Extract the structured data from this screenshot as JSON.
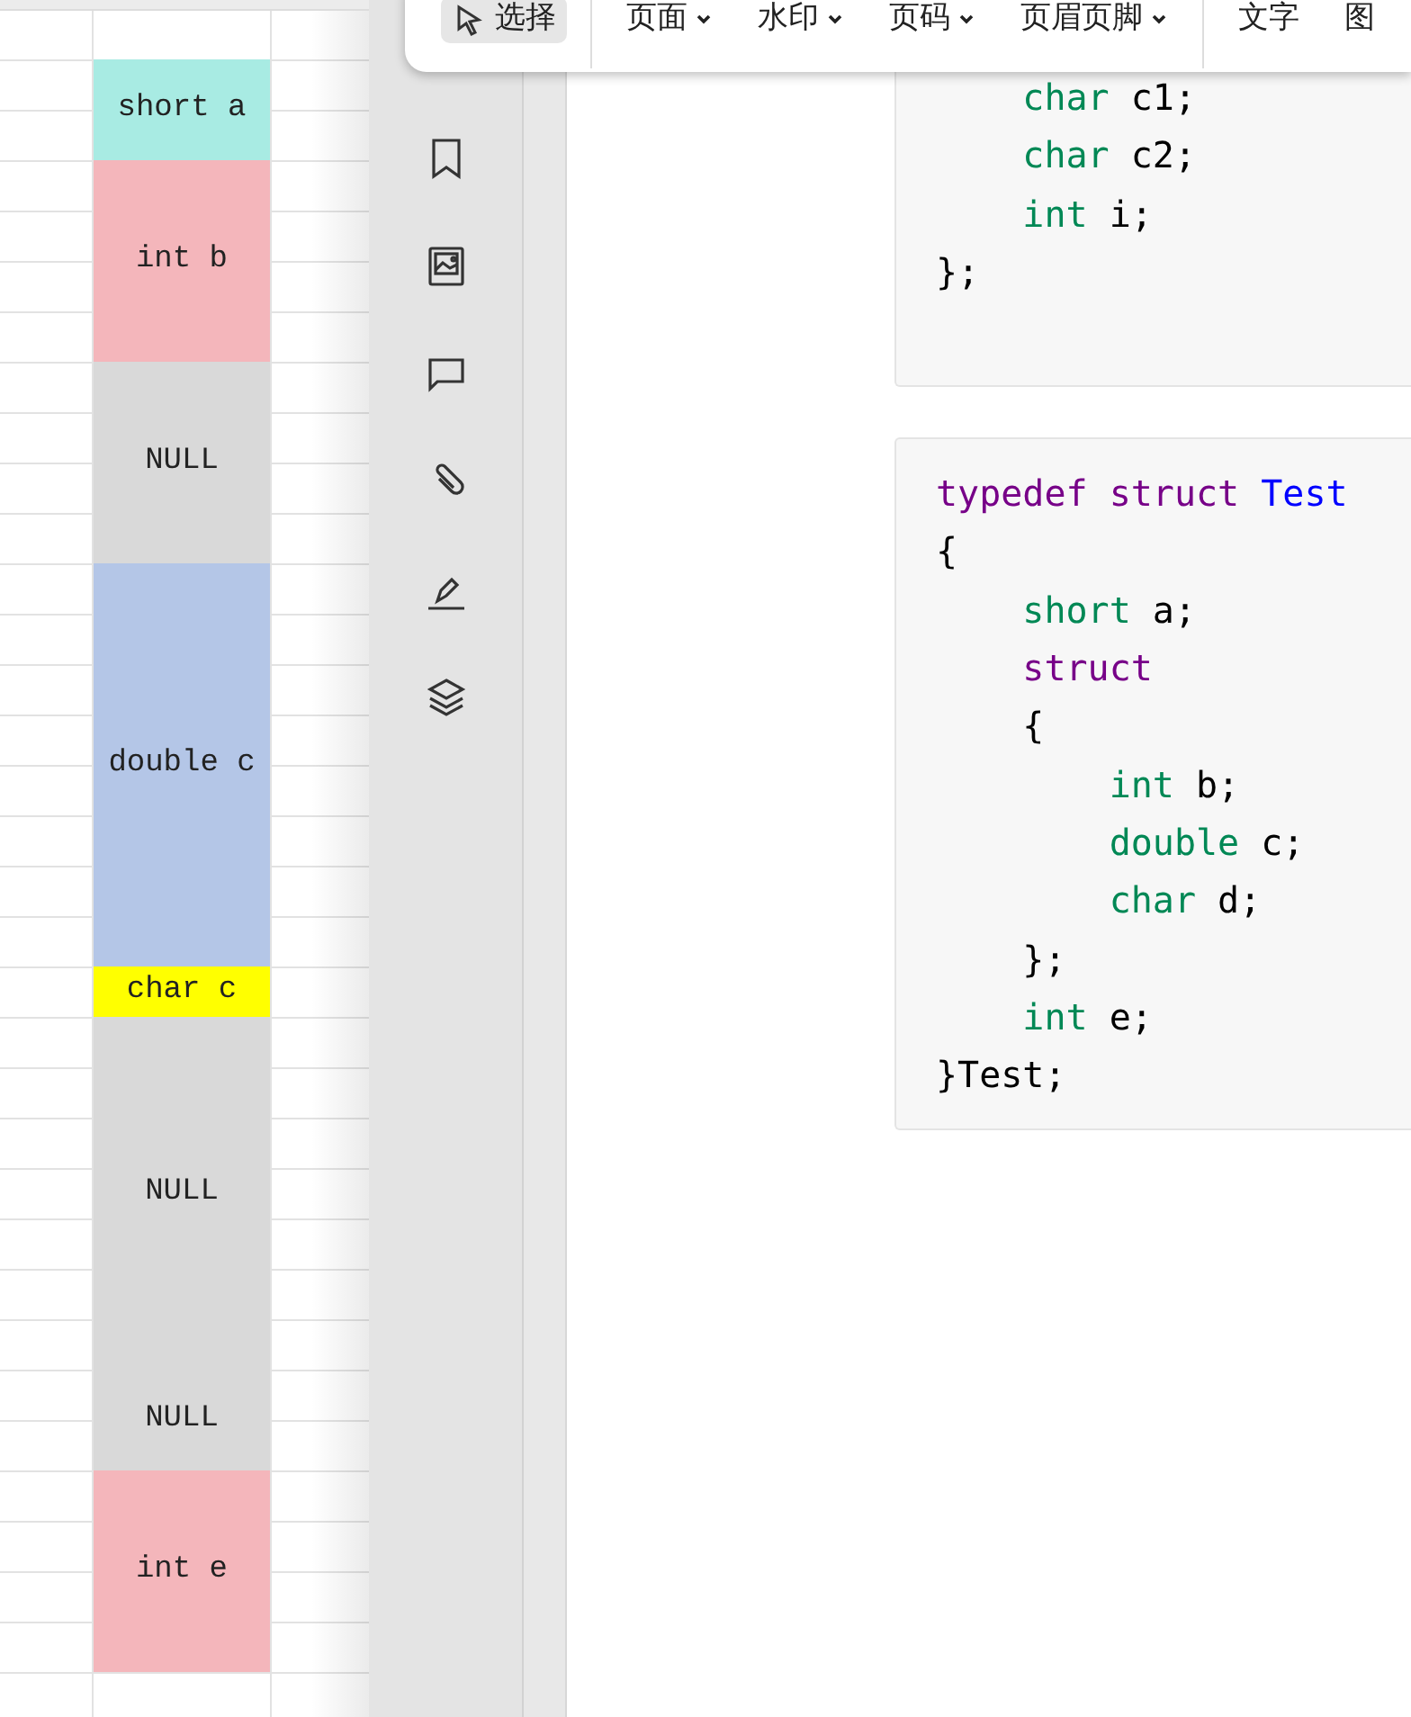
{
  "sheet": {
    "cells": [
      {
        "text": "short a",
        "color": "#a8ebe3"
      },
      {
        "text": "int b",
        "color": "#f4b6bb"
      },
      {
        "text": "NULL",
        "color": "#d9d9d9"
      },
      {
        "text": "double c",
        "color": "#b4c6e7"
      },
      {
        "text": "char c",
        "color": "#ffff00"
      },
      {
        "text": "NULL",
        "color": "#d9d9d9"
      },
      {
        "text": "NULL",
        "color": "#d9d9d9"
      },
      {
        "text": "int e",
        "color": "#f4b6bb"
      }
    ]
  },
  "toolbar": {
    "items": [
      {
        "label": "选择",
        "kind": "tool",
        "selected": true
      },
      {
        "label": "页面",
        "kind": "dropdown",
        "selected": false
      },
      {
        "label": "水印",
        "kind": "dropdown",
        "selected": false
      },
      {
        "label": "页码",
        "kind": "dropdown",
        "selected": false
      },
      {
        "label": "页眉页脚",
        "kind": "dropdown",
        "selected": false
      },
      {
        "label": "文字",
        "kind": "plain",
        "selected": false
      },
      {
        "label": "图",
        "kind": "plain",
        "selected": false
      }
    ]
  },
  "code_blocks": [
    {
      "lines": [
        [
          {
            "kind": "type",
            "text": "    char"
          },
          {
            "kind": "plain",
            "text": " c1;"
          }
        ],
        [
          {
            "kind": "type",
            "text": "    char"
          },
          {
            "kind": "plain",
            "text": " c2;"
          }
        ],
        [
          {
            "kind": "type",
            "text": "    int"
          },
          {
            "kind": "plain",
            "text": " i;"
          }
        ],
        [
          {
            "kind": "plain",
            "text": "};"
          }
        ]
      ]
    },
    {
      "lines": [
        [
          {
            "kind": "keyword",
            "text": "typedef"
          },
          {
            "kind": "keyword",
            "text": " struct"
          },
          {
            "kind": "name",
            "text": " Test"
          }
        ],
        [
          {
            "kind": "plain",
            "text": "{"
          }
        ],
        [
          {
            "kind": "type",
            "text": "    short"
          },
          {
            "kind": "plain",
            "text": " a;"
          }
        ],
        [
          {
            "kind": "keyword",
            "text": "    struct"
          }
        ],
        [
          {
            "kind": "plain",
            "text": "    {"
          }
        ],
        [
          {
            "kind": "type",
            "text": "        int"
          },
          {
            "kind": "plain",
            "text": " b;"
          }
        ],
        [
          {
            "kind": "type",
            "text": "        double"
          },
          {
            "kind": "plain",
            "text": " c;"
          }
        ],
        [
          {
            "kind": "type",
            "text": "        char"
          },
          {
            "kind": "plain",
            "text": " d;"
          }
        ],
        [
          {
            "kind": "plain",
            "text": "    };"
          }
        ],
        [
          {
            "kind": "type",
            "text": "    int"
          },
          {
            "kind": "plain",
            "text": " e;"
          }
        ],
        [
          {
            "kind": "plain",
            "text": "}Test;"
          }
        ]
      ]
    }
  ]
}
